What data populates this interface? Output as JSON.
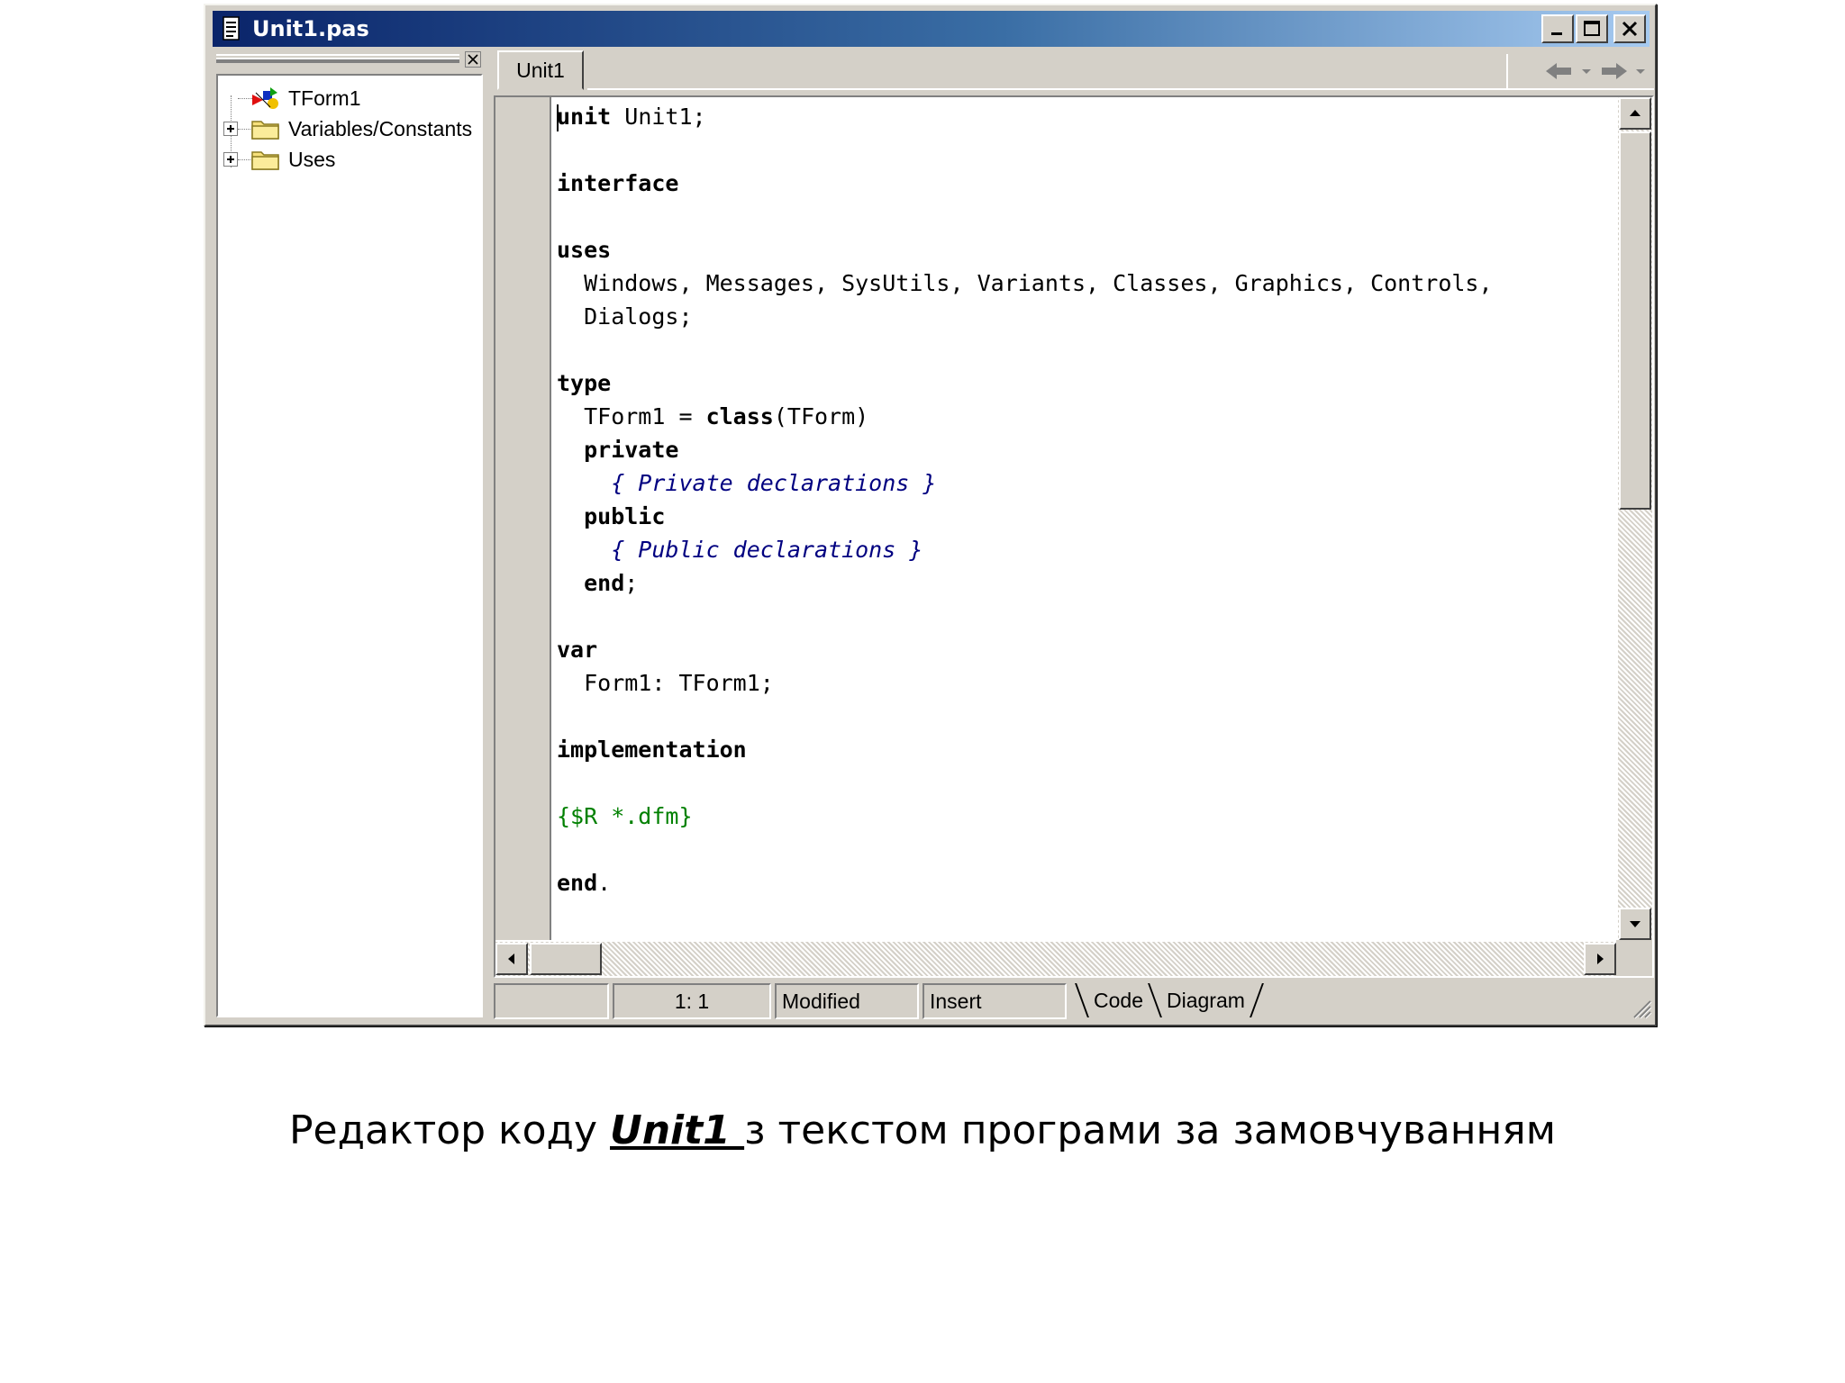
{
  "window": {
    "title": "Unit1.pas"
  },
  "tree": {
    "items": [
      {
        "label": "TForm1",
        "icon": "form-icon",
        "expandable": false
      },
      {
        "label": "Variables/Constants",
        "icon": "folder-icon",
        "expandable": true
      },
      {
        "label": "Uses",
        "icon": "folder-icon",
        "expandable": true
      }
    ]
  },
  "editor": {
    "tab_label": "Unit1",
    "lines": [
      {
        "segments": [
          {
            "t": "unit",
            "k": "kw"
          },
          {
            "t": " Unit1;",
            "k": ""
          }
        ]
      },
      {
        "segments": []
      },
      {
        "segments": [
          {
            "t": "interface",
            "k": "kw"
          }
        ]
      },
      {
        "segments": []
      },
      {
        "segments": [
          {
            "t": "uses",
            "k": "kw"
          }
        ]
      },
      {
        "segments": [
          {
            "t": "  Windows, Messages, SysUtils, Variants, Classes, Graphics, Controls,",
            "k": ""
          }
        ]
      },
      {
        "segments": [
          {
            "t": "  Dialogs;",
            "k": ""
          }
        ]
      },
      {
        "segments": []
      },
      {
        "segments": [
          {
            "t": "type",
            "k": "kw"
          }
        ]
      },
      {
        "segments": [
          {
            "t": "  TForm1 = ",
            "k": ""
          },
          {
            "t": "class",
            "k": "kw"
          },
          {
            "t": "(TForm)",
            "k": ""
          }
        ]
      },
      {
        "segments": [
          {
            "t": "  private",
            "k": "kw"
          }
        ]
      },
      {
        "segments": [
          {
            "t": "    { Private declarations }",
            "k": "cm"
          }
        ]
      },
      {
        "segments": [
          {
            "t": "  public",
            "k": "kw"
          }
        ]
      },
      {
        "segments": [
          {
            "t": "    { Public declarations }",
            "k": "cm"
          }
        ]
      },
      {
        "segments": [
          {
            "t": "  end",
            "k": "kw"
          },
          {
            "t": ";",
            "k": ""
          }
        ]
      },
      {
        "segments": []
      },
      {
        "segments": [
          {
            "t": "var",
            "k": "kw"
          }
        ]
      },
      {
        "segments": [
          {
            "t": "  Form1: TForm1;",
            "k": ""
          }
        ]
      },
      {
        "segments": []
      },
      {
        "segments": [
          {
            "t": "implementation",
            "k": "kw"
          }
        ]
      },
      {
        "segments": []
      },
      {
        "segments": [
          {
            "t": "{$R *.dfm}",
            "k": "dr"
          }
        ]
      },
      {
        "segments": []
      },
      {
        "segments": [
          {
            "t": "end",
            "k": "kw"
          },
          {
            "t": ".",
            "k": ""
          }
        ]
      }
    ]
  },
  "statusbar": {
    "position": "1:   1",
    "modified": "Modified",
    "mode": "Insert",
    "view_tabs": [
      "Code",
      "Diagram"
    ]
  },
  "caption": {
    "before": "Редактор коду ",
    "emphasis": "Unit1 ",
    "after": "з текстом програми за замовчуванням"
  },
  "colors": {
    "title_gradient_start": "#0a246a",
    "title_gradient_end": "#a6caf0",
    "comment": "#000080",
    "directive": "#008000",
    "face": "#d4d0c8"
  }
}
